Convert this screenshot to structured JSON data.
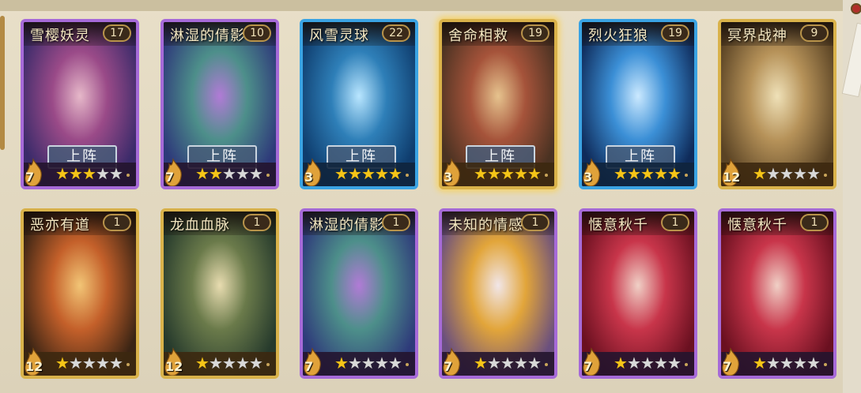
{
  "colors": {
    "purple_frame": "#a66ad8",
    "blue_frame": "#3aa3e3",
    "gold_frame": "#d9b24a",
    "star_on": "#f5c518",
    "star_off": "#d8d8d8"
  },
  "cards": [
    {
      "name": "雪樱妖灵",
      "level": "17",
      "rank": "7",
      "stars": 3,
      "max_stars": 5,
      "frame": "purple",
      "deploy": "上阵",
      "art": [
        "#3b2b6a",
        "#9a4a88",
        "#e6b8c9"
      ]
    },
    {
      "name": "淋湿的倩影",
      "level": "10",
      "rank": "7",
      "stars": 2,
      "max_stars": 5,
      "frame": "purple",
      "deploy": "上阵",
      "art": [
        "#2e3a7a",
        "#4d8f8a",
        "#b17bd6"
      ]
    },
    {
      "name": "风雪灵球",
      "level": "22",
      "rank": "3",
      "stars": 5,
      "max_stars": 5,
      "frame": "blue",
      "deploy": "上阵",
      "art": [
        "#0f3d6e",
        "#2e7fb8",
        "#b9e6ff"
      ]
    },
    {
      "name": "舍命相救",
      "level": "19",
      "rank": "3",
      "stars": 5,
      "max_stars": 5,
      "frame": "gold",
      "deploy": "上阵",
      "selected": true,
      "art": [
        "#4a3222",
        "#a5533a",
        "#e6c38e"
      ]
    },
    {
      "name": "烈火狂狼",
      "level": "19",
      "rank": "3",
      "stars": 5,
      "max_stars": 5,
      "frame": "blue",
      "deploy": "上阵",
      "art": [
        "#0f2b5a",
        "#3b8fd6",
        "#cbe9ff"
      ]
    },
    {
      "name": "冥界战神",
      "level": "9",
      "rank": "12",
      "stars": 1,
      "max_stars": 5,
      "frame": "gold",
      "deploy": "",
      "art": [
        "#5a4324",
        "#b69259",
        "#efe1b8"
      ]
    },
    {
      "name": "恶亦有道",
      "level": "1",
      "rank": "12",
      "stars": 1,
      "max_stars": 5,
      "frame": "gold",
      "deploy": "",
      "art": [
        "#3a2414",
        "#c4602a",
        "#f2c576"
      ]
    },
    {
      "name": "龙血血脉",
      "level": "1",
      "rank": "12",
      "stars": 1,
      "max_stars": 5,
      "frame": "gold",
      "deploy": "",
      "art": [
        "#263a2c",
        "#6a7a4a",
        "#e8dcb0"
      ]
    },
    {
      "name": "淋湿的倩影",
      "level": "1",
      "rank": "7",
      "stars": 1,
      "max_stars": 5,
      "frame": "purple",
      "deploy": "",
      "art": [
        "#2e3a7a",
        "#4d8f8a",
        "#b17bd6"
      ]
    },
    {
      "name": "未知的情感",
      "level": "1",
      "rank": "7",
      "stars": 1,
      "max_stars": 5,
      "frame": "purple",
      "deploy": "",
      "art": [
        "#6a4f7e",
        "#e2a53a",
        "#f1e6e8"
      ]
    },
    {
      "name": "惬意秋千",
      "level": "1",
      "rank": "7",
      "stars": 1,
      "max_stars": 5,
      "frame": "purple",
      "deploy": "",
      "art": [
        "#6a1020",
        "#c8354a",
        "#f0d0c6"
      ]
    },
    {
      "name": "惬意秋千",
      "level": "1",
      "rank": "7",
      "stars": 1,
      "max_stars": 5,
      "frame": "purple",
      "deploy": "",
      "art": [
        "#6a1020",
        "#c8354a",
        "#f0d0c6"
      ]
    }
  ]
}
